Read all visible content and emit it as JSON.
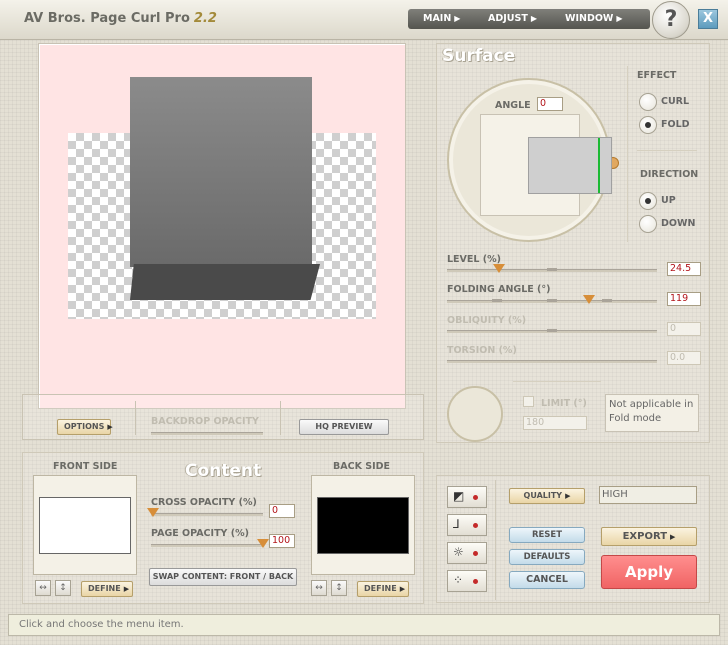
{
  "titlebar": {
    "app_name": "AV Bros. Page Curl Pro",
    "version": "2.2",
    "menu": [
      {
        "label": "MAIN"
      },
      {
        "label": "ADJUST"
      },
      {
        "label": "WINDOW"
      }
    ],
    "help_label": "?",
    "close_label": "X"
  },
  "options_strip": {
    "options_label": "OPTIONS",
    "backdrop_opacity_label": "BACKDROP OPACITY",
    "hq_preview_label": "HQ PREVIEW"
  },
  "surface": {
    "title": "Surface",
    "angle_label": "ANGLE",
    "angle_value": "0",
    "effect_label": "EFFECT",
    "effect_options": [
      {
        "label": "CURL",
        "checked": false
      },
      {
        "label": "FOLD",
        "checked": true
      }
    ],
    "direction_label": "DIRECTION",
    "direction_options": [
      {
        "label": "UP",
        "checked": true
      },
      {
        "label": "DOWN",
        "checked": false
      }
    ],
    "sliders": [
      {
        "label": "LEVEL (%)",
        "value": "24.5",
        "enabled": true,
        "fraction": 0.245
      },
      {
        "label": "FOLDING ANGLE (°)",
        "value": "119",
        "enabled": true,
        "fraction": 0.66
      },
      {
        "label": "OBLIQUITY (%)",
        "value": "0",
        "enabled": false,
        "fraction": 0.0
      },
      {
        "label": "TORSION (%)",
        "value": "0.0",
        "enabled": false,
        "fraction": 0.0
      }
    ],
    "limit_label": "LIMIT (°)",
    "limit_value": "180",
    "note": "Not applicable in Fold mode"
  },
  "content": {
    "title": "Content",
    "front_side_label": "FRONT SIDE",
    "back_side_label": "BACK SIDE",
    "front_color": "#ffffff",
    "back_color": "#000000",
    "cross_opacity_label": "CROSS OPACITY (%)",
    "cross_opacity_value": "0",
    "page_opacity_label": "PAGE OPACITY (%)",
    "page_opacity_value": "100",
    "swap_label": "SWAP CONTENT: FRONT / BACK",
    "define_label": "DEFINE"
  },
  "actions": {
    "quality_label": "QUALITY",
    "quality_value": "HIGH",
    "reset_label": "RESET",
    "defaults_label": "DEFAULTS",
    "cancel_label": "CANCEL",
    "export_label": "EXPORT",
    "apply_label": "Apply"
  },
  "status_text": "Click and choose the menu item.",
  "colors": {
    "accent_orange": "#d78e39",
    "apply_red": "#f06464",
    "value_red": "#b3151a",
    "preview_bg": "#ffe4e4"
  }
}
